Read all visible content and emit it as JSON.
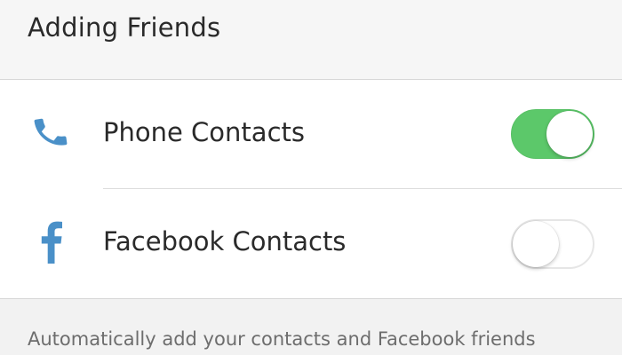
{
  "section": {
    "title": "Adding Friends"
  },
  "rows": [
    {
      "label": "Phone Contacts",
      "icon": "phone-icon",
      "enabled": true
    },
    {
      "label": "Facebook Contacts",
      "icon": "facebook-icon",
      "enabled": false
    }
  ],
  "footer": {
    "text": "Automatically add your contacts and Facebook friends"
  },
  "colors": {
    "toggle_on": "#5cc86a",
    "icon_blue": "#4a90c8",
    "background": "#f2f2f2"
  }
}
